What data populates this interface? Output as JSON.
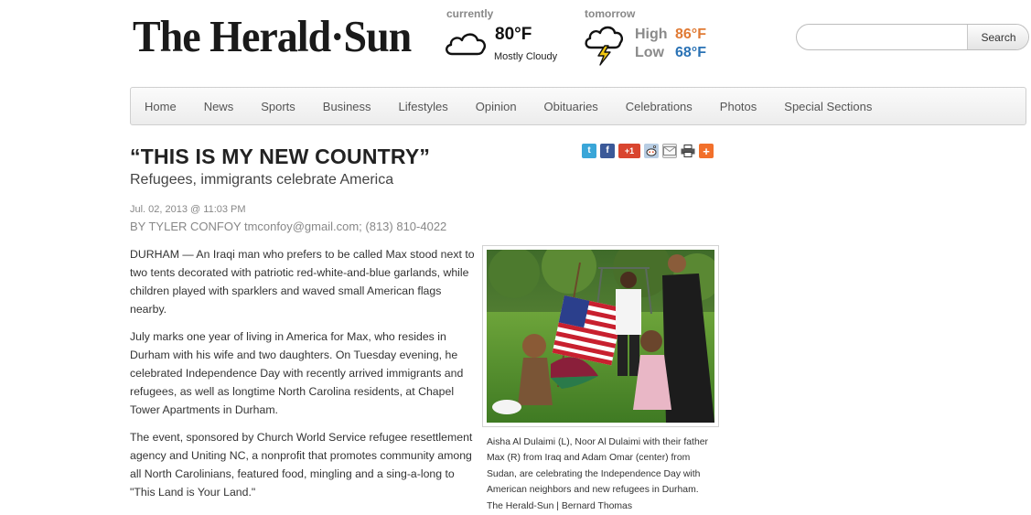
{
  "masthead": {
    "logo_text": "The Herald·Sun"
  },
  "weather": {
    "current_label": "currently",
    "current_temp": "80°F",
    "current_condition": "Mostly Cloudy",
    "current_icon": "cloud-icon",
    "tomorrow_label": "tomorrow",
    "tomorrow_icon": "thunderstorm-icon",
    "high_label": "High",
    "high_value": "86°F",
    "low_label": "Low",
    "low_value": "68°F",
    "colors": {
      "high": "#e07a34",
      "low": "#2a72b5"
    }
  },
  "search": {
    "value": "",
    "placeholder": "",
    "button_label": "Search"
  },
  "nav": {
    "items": [
      "Home",
      "News",
      "Sports",
      "Business",
      "Lifestyles",
      "Opinion",
      "Obituaries",
      "Celebrations",
      "Photos",
      "Special Sections"
    ]
  },
  "article": {
    "headline": "“THIS IS MY NEW COUNTRY”",
    "subhead": "Refugees, immigrants celebrate America",
    "date": "Jul. 02, 2013 @ 11:03 PM",
    "byline": "BY TYLER CONFOY tmconfoy@gmail.com; (813) 810-4022",
    "paragraphs": [
      "DURHAM — An Iraqi man who prefers to be called Max stood next to two tents decorated with patriotic red-white-and-blue garlands, while children played with sparklers and waved small American flags nearby.",
      "July marks one year of living in America for Max, who resides in Durham with his wife and two daughters. On Tuesday evening, he celebrated Independence Day with recently arrived immigrants and refugees, as well as longtime North Carolina residents, at Chapel Tower Apartments in Durham.",
      "The event, sponsored by Church World Service refugee resettlement agency and Uniting NC, a nonprofit that promotes community among all North Carolinians, featured food, mingling and a sing-a-long to \"This Land is Your Land.\""
    ],
    "photo_caption": "Aisha Al Dulaimi (L), Noor Al Dulaimi with their father Max (R) from Iraq and Adam Omar (center) from Sudan, are celebrating the Independence Day with American neighbors and new refugees in Durham. The Herald-Sun | Bernard Thomas"
  },
  "share": {
    "icons": [
      "twitter-icon",
      "facebook-icon",
      "google-plus-icon",
      "reddit-icon",
      "email-icon",
      "print-icon",
      "add-this-icon"
    ],
    "gplus_text": "+1"
  }
}
